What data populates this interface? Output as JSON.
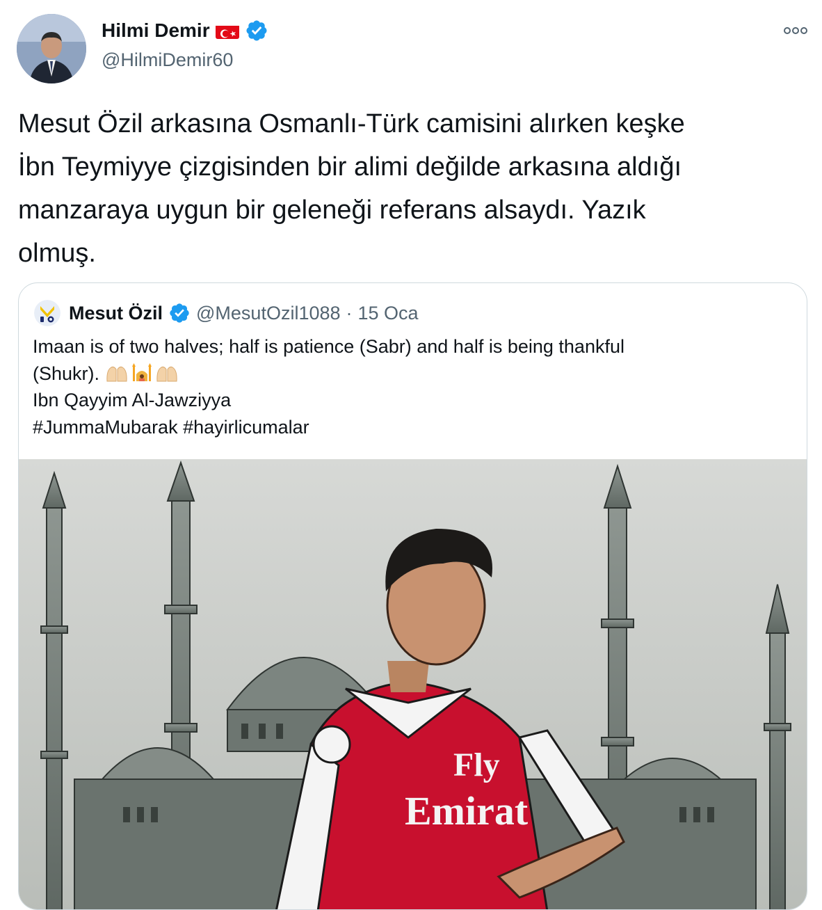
{
  "author": {
    "name": "Hilmi Demir",
    "handle": "@HilmiDemir60",
    "flag_icon": "turkey-flag-icon",
    "verified_icon": "verified-badge-icon"
  },
  "tweet": {
    "text": "Mesut Özil arkasına Osmanlı-Türk camisini alırken keşke\nİbn Teymiyye çizgisinden bir alimi değilde arkasına aldığı\nmanzaraya uygun bir geleneği referans alsaydı. Yazık\nolmuş."
  },
  "quoted": {
    "name": "Mesut Özil",
    "handle": "@MesutOzil1088",
    "separator": "·",
    "date": "15 Oca",
    "lines": [
      "Imaan is of two halves;  half is patience (Sabr) and half is being thankful",
      "(Shukr).",
      "Ibn Qayyim Al-Jawziyya",
      "#JummaMubarak #hayirlicumalar"
    ],
    "emojis": [
      "praying-hands-icon",
      "person-praying-mosque-icon",
      "praying-hands-icon"
    ],
    "media": {
      "jersey_sponsor_line1": "Fly",
      "jersey_sponsor_line2": "Emirat"
    }
  },
  "colors": {
    "text": "#0f1419",
    "secondary": "#536471",
    "verified": "#1d9bf0",
    "border": "#cfd9de",
    "flag_red": "#e30a17",
    "jersey_red": "#c8102e"
  }
}
